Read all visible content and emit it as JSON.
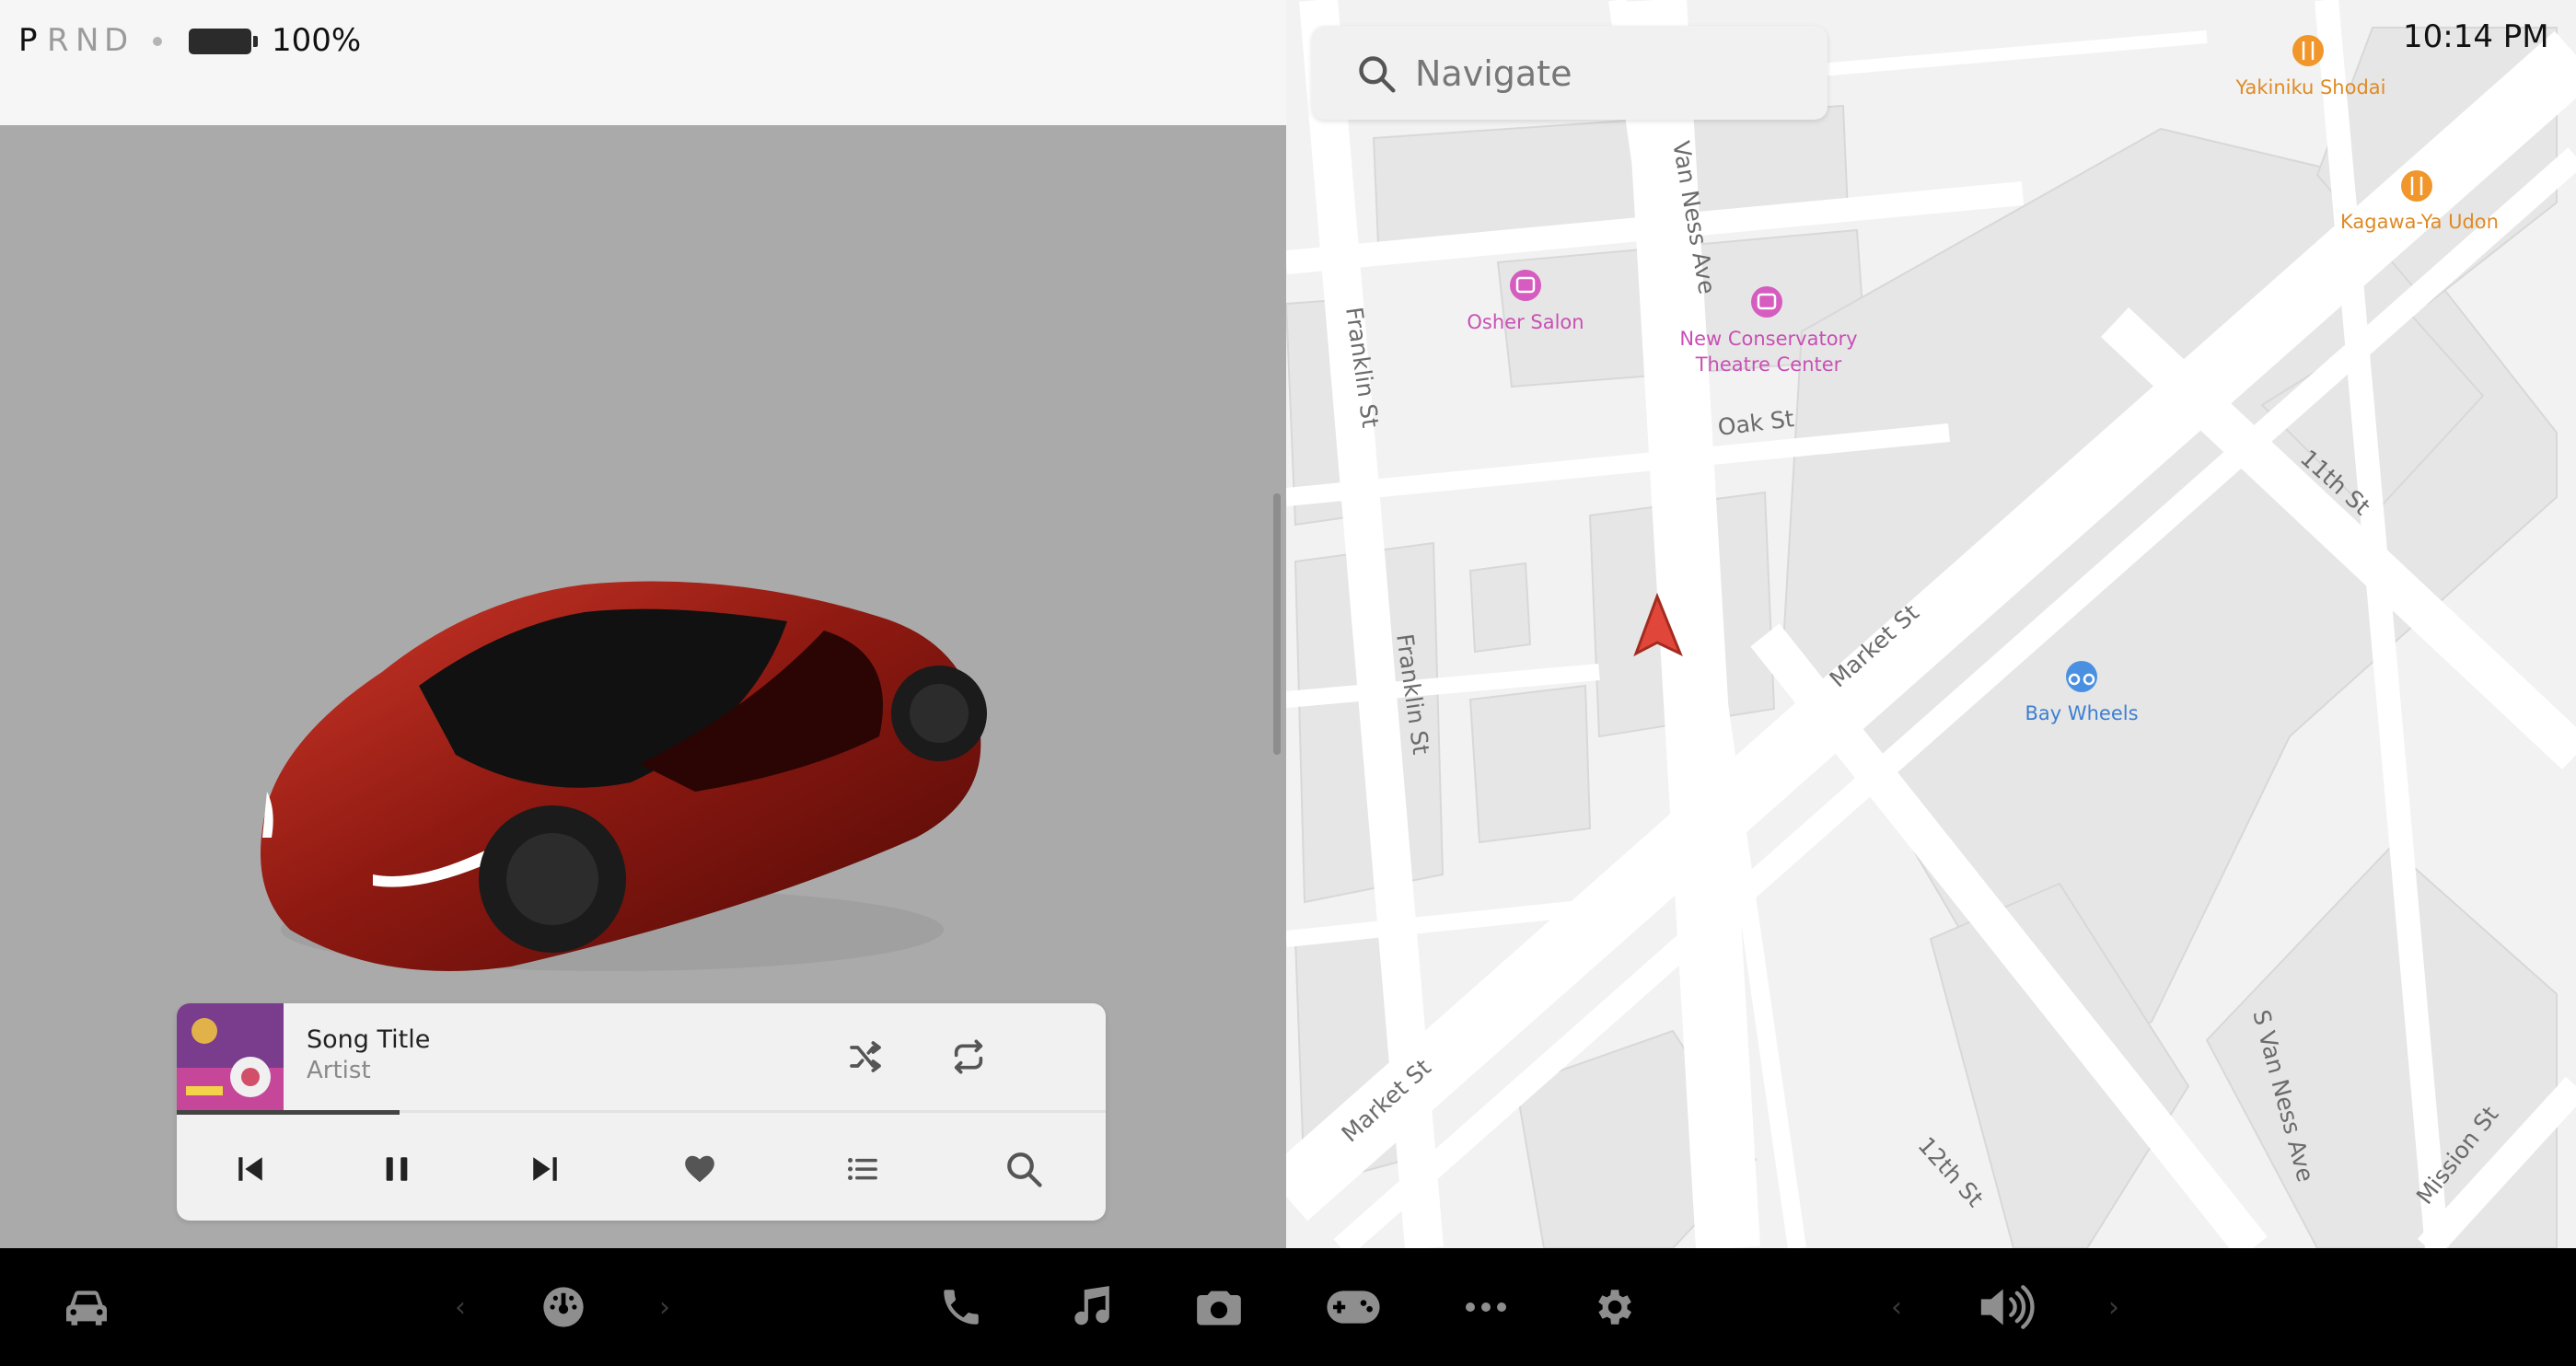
{
  "status": {
    "gears": [
      "P",
      "R",
      "N",
      "D"
    ],
    "active_gear": "P",
    "battery_percent": "100%"
  },
  "player": {
    "song_title": "Song Title",
    "artist": "Artist",
    "progress": 0.24,
    "icons": [
      "shuffle-icon",
      "repeat-icon",
      "previous-icon",
      "pause-icon",
      "next-icon",
      "heart-icon",
      "list-icon",
      "search-icon"
    ]
  },
  "map": {
    "search_placeholder": "Navigate",
    "clock": "10:14 PM",
    "streets": [
      "Franklin St",
      "Franklin St",
      "Van Ness Ave",
      "Oak St",
      "11th St",
      "Market St",
      "Market St",
      "12th St",
      "S Van Ness Ave",
      "Mission St"
    ],
    "pois": [
      {
        "name": "Yakiniku Shodai",
        "color": "#f0962b",
        "icon": "restaurant-icon"
      },
      {
        "name": "Kagawa-Ya Udon",
        "color": "#f0962b",
        "icon": "restaurant-icon"
      },
      {
        "name": "Osher Salon",
        "color": "#d65cc0",
        "icon": "theater-icon"
      },
      {
        "name": "New Conservatory",
        "name2": "Theatre Center",
        "color": "#d65cc0",
        "icon": "theater-icon"
      },
      {
        "name": "Bay Wheels",
        "color": "#4a90e2",
        "icon": "bike-icon"
      }
    ],
    "nav_arrow_color": "#e0473a"
  },
  "taskbar": {
    "icons": [
      "car-icon",
      "chevron-left-icon",
      "dashboard-icon",
      "chevron-right-icon",
      "phone-icon",
      "music-icon",
      "camera-icon",
      "gamepad-icon",
      "more-icon",
      "settings-icon",
      "chevron-left-icon",
      "volume-icon",
      "chevron-right-icon"
    ]
  }
}
